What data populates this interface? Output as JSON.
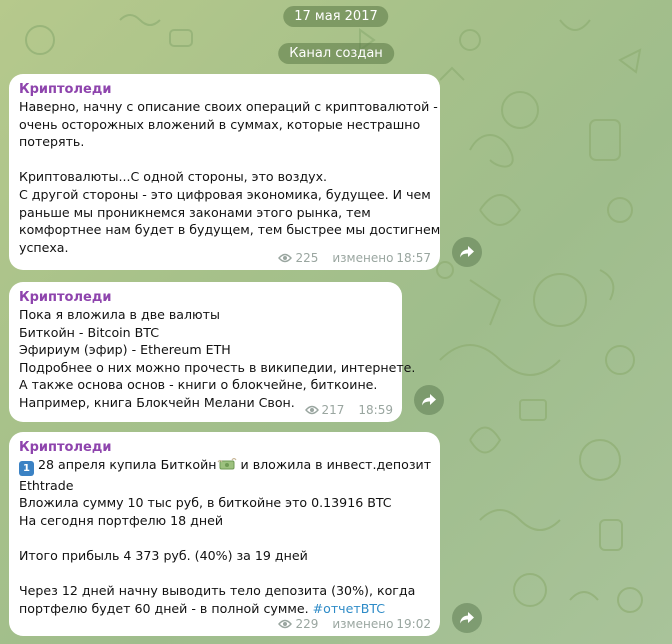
{
  "date_pill": "17 мая 2017",
  "service_pill": "Канал создан",
  "messages": [
    {
      "sender": "Криптоледи",
      "lines": [
        "Наверно, начну с описание своих операций с криптовалютой -",
        "очень осторожных вложений в суммах, которые нестрашно",
        "потерять.",
        "",
        "Криптовалюты...С одной стороны, это воздух.",
        "С другой стороны - это цифровая экономика, будущее. И чем",
        "раньше мы проникнемся законами этого рынка, тем",
        "комфортнее нам будет в будущем, тем быстрее мы достигнем",
        "успеха."
      ],
      "views": "225",
      "edited": "изменено",
      "time": "18:57"
    },
    {
      "sender": "Криптоледи",
      "lines": [
        "Пока я вложила в две валюты",
        "Биткойн - Bitcoin BTC",
        "Эфириум (эфир) - Ethereum ETH",
        "Подробнее о них можно прочесть в википедии, интернете.",
        "А также основа основ - книги о блокчейне, биткоине.",
        "Например, книга Блокчейн Мелани Свон."
      ],
      "views": "217",
      "edited": "",
      "time": "18:59"
    },
    {
      "sender": "Криптоледи",
      "emoji_number": "1",
      "line1_a": "28 апреля купила Биткойн",
      "line1_b": " и вложила в инвест.депозит",
      "lines": [
        "Ethtrade",
        "Вложила сумму 10 тыс руб, в биткойне это 0.13916 BTC",
        "На сегодня портфелю 18 дней",
        "",
        "Итого прибыль 4 373 руб. (40%) за 19 дней",
        "",
        "Через 12 дней начну выводить тело депозита (30%), когда"
      ],
      "last_line_text": "портфелю будет 60 дней - в полной сумме. ",
      "hashtag": "#отчетBTC",
      "views": "229",
      "edited": "изменено",
      "time": "19:02"
    }
  ],
  "icons": {
    "views": "eye-icon",
    "forward": "share-arrow-icon",
    "money": "money-with-wings-emoji",
    "keycap": "keycap-one-emoji"
  },
  "colors": {
    "sender": "#8e44ad",
    "hashtag": "#2e8bc7",
    "meta": "#9aa6a0"
  }
}
